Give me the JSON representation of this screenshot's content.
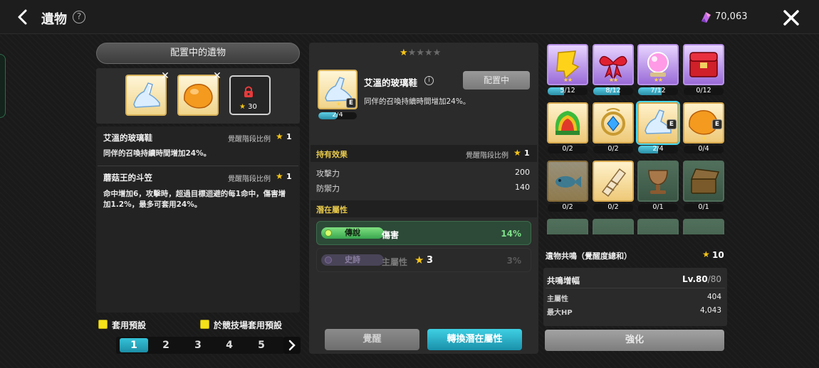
{
  "header": {
    "title": "遺物",
    "help_icon": "question-circle-icon",
    "currency_icon": "gem-icon",
    "currency_value": "70,063",
    "close_icon": "close-icon"
  },
  "left": {
    "equipped_title": "配置中的遺物",
    "locked_slot_stars": "30",
    "effects": [
      {
        "name": "艾溫的玻璃鞋",
        "ratio_label": "覺醒階段比例",
        "ratio_value": "1",
        "desc": "同伴的召喚持續時間增加24%。"
      },
      {
        "name": "蘑菇王的斗笠",
        "ratio_label": "覺醒階段比例",
        "ratio_value": "1",
        "desc": "命中增加6，攻擊時，超過目標迴避的每1命中，傷害增加1.2%，最多可套用24%。"
      }
    ],
    "preset_label": "套用預設",
    "arena_preset_label": "於競技場套用預設",
    "pages": [
      "1",
      "2",
      "3",
      "4",
      "5"
    ],
    "active_page": "1"
  },
  "detail": {
    "rating_filled": 1,
    "rating_total": 5,
    "name": "艾溫的玻璃鞋",
    "equip_state": "配置中",
    "desc": "同伴的召喚持續時間增加24%。",
    "count": "2/4",
    "count_progress": 0.5,
    "hold_title": "持有效果",
    "hold_ratio_label": "覺醒階段比例",
    "hold_ratio_value": "1",
    "stats": [
      {
        "label": "攻擊力",
        "value": "200"
      },
      {
        "label": "防禦力",
        "value": "140"
      }
    ],
    "latent_title": "潛在屬性",
    "latent": [
      {
        "grade": "傳說",
        "name": "傷害",
        "value": "14%"
      },
      {
        "grade": "史詩",
        "name": "主屬性",
        "value": "3%",
        "stars": "3"
      }
    ],
    "btn_awaken": "覺醒",
    "btn_convert": "轉換潛在屬性"
  },
  "grid": {
    "items": [
      {
        "icon": "golden-ticket-icon",
        "count": "5/12",
        "progress": 0.4167
      },
      {
        "icon": "red-ribbon-icon",
        "count": "8/12",
        "progress": 0.6667
      },
      {
        "icon": "crystal-orb-icon",
        "count": "7/12",
        "progress": 0.5833
      },
      {
        "icon": "red-treasure-chest-icon",
        "count": "0/12",
        "progress": 0
      },
      {
        "icon": "rainbow-shell-icon",
        "count": "0/2",
        "progress": 0
      },
      {
        "icon": "blue-gem-amulet-icon",
        "count": "0/2",
        "progress": 0
      },
      {
        "icon": "glass-slipper-icon",
        "count": "2/4",
        "progress": 0.5
      },
      {
        "icon": "mushroom-cap-icon",
        "count": "0/4",
        "progress": 0
      },
      {
        "icon": "blue-fish-icon",
        "count": "0/2",
        "progress": 0
      },
      {
        "icon": "bandage-scroll-icon",
        "count": "0/2",
        "progress": 0
      },
      {
        "icon": "bronze-chalice-icon",
        "count": "0/1",
        "progress": 0
      },
      {
        "icon": "open-chest-icon",
        "count": "0/1",
        "progress": 0
      }
    ]
  },
  "resonance": {
    "title": "遺物共鳴（覺醒度總和）",
    "value": "10",
    "amp_title": "共鳴增幅",
    "level": "Lv.80",
    "level_max": "/80",
    "rows": [
      {
        "label": "主屬性",
        "value": "404"
      },
      {
        "label": "最大HP",
        "value": "4,043"
      }
    ],
    "btn_enhance": "強化"
  }
}
